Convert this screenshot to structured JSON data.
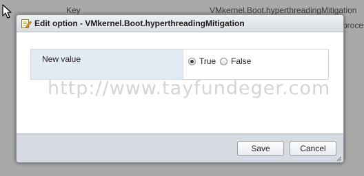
{
  "background": {
    "key_header": "Key",
    "value_text": "VMkernel.Boot.hyperthreadingMitigation",
    "description_fragment": "proces"
  },
  "dialog": {
    "title": "Edit option - VMkernel.Boot.hyperthreadingMitigation",
    "title_icon": "edit-note-icon",
    "field_label": "New value",
    "options": [
      {
        "label": "True",
        "checked": true
      },
      {
        "label": "False",
        "checked": false
      }
    ],
    "watermark": "http://www.tayfundeger.com",
    "save_label": "Save",
    "cancel_label": "Cancel"
  },
  "colors": {
    "label_cell_bg": "#e3ecf5",
    "footer_bg": "#d6dbe1",
    "titlebar_bg": "#e4e8ec"
  }
}
